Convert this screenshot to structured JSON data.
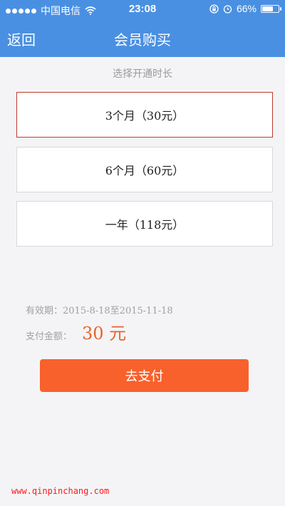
{
  "status_bar": {
    "carrier": "中国电信",
    "time": "23:08",
    "battery": "66%",
    "battery_level": 0.66
  },
  "nav": {
    "back_label": "返回",
    "title": "会员购买"
  },
  "duration_section": {
    "label": "选择开通时长",
    "options": [
      {
        "label": "3个月（30元）",
        "selected": true
      },
      {
        "label": "6个月（60元）",
        "selected": false
      },
      {
        "label": "一年（118元）",
        "selected": false
      }
    ]
  },
  "summary": {
    "validity": "有效期：2015-8-18至2015-11-18",
    "amount_label": "支付金额：",
    "amount_value": "30 元"
  },
  "pay_button_label": "去支付",
  "watermark": "www.qinpinchang.com",
  "colors": {
    "header": "#4a90e2",
    "selected_border": "#c0392b",
    "amount": "#e8642c",
    "pay_button": "#f8612c",
    "watermark": "#ff1a1a"
  }
}
